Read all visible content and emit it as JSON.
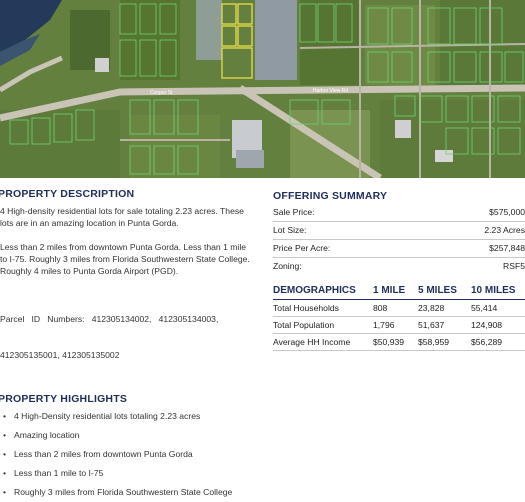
{
  "map": {
    "road_label_1": "Cooper St",
    "road_label_2": "Harbor View Rd"
  },
  "property_description": {
    "title": "PROPERTY DESCRIPTION",
    "p1_line1": "4 High-density residential lots for sale totaling 2.23 acres. These",
    "p1_line2": "lots are in an amazing location in Punta Gorda.",
    "p2_line1": "Less than 2 miles from downtown Punta Gorda. Less than 1 mile",
    "p2_line2": "to I-75. Roughly 3 miles from Florida Southwestern State College.",
    "p2_line3": "Roughly 4 miles to Punta Gorda Airport (PGD).",
    "p3_line1": "Parcel   ID   Numbers:   412305134002,   412305134003,",
    "p3_line2": "412305135001, 412305135002"
  },
  "property_highlights": {
    "title": "PROPERTY HIGHLIGHTS",
    "items": [
      "4 High-Density residential lots totaling 2.23 acres",
      "Amazing location",
      "Less than 2 miles from downtown Punta Gorda",
      "Less than 1 mile to I-75",
      "Roughly 3 miles from Florida Southwestern State College"
    ],
    "bullet": "•"
  },
  "offering_summary": {
    "title": "OFFERING SUMMARY",
    "rows": [
      {
        "label": "Sale Price:",
        "value": "$575,000"
      },
      {
        "label": "Lot Size:",
        "value": "2.23 Acres"
      },
      {
        "label": "Price Per Acre:",
        "value": "$257,848"
      },
      {
        "label": "Zoning:",
        "value": "RSF5"
      }
    ]
  },
  "demographics": {
    "title": "DEMOGRAPHICS",
    "columns": [
      "1 MILE",
      "5 MILES",
      "10 MILES"
    ],
    "rows": [
      {
        "label": "Total Households",
        "values": [
          "808",
          "23,828",
          "55,414"
        ]
      },
      {
        "label": "Total Population",
        "values": [
          "1,796",
          "51,637",
          "124,908"
        ]
      },
      {
        "label": "Average HH Income",
        "values": [
          "$50,939",
          "$58,959",
          "$56,289"
        ]
      }
    ]
  },
  "colors": {
    "heading": "#1f2d5a",
    "rule": "#c8c8c8",
    "parcel_outline": "#f2e34a",
    "lot_outline": "#6fd36f"
  }
}
